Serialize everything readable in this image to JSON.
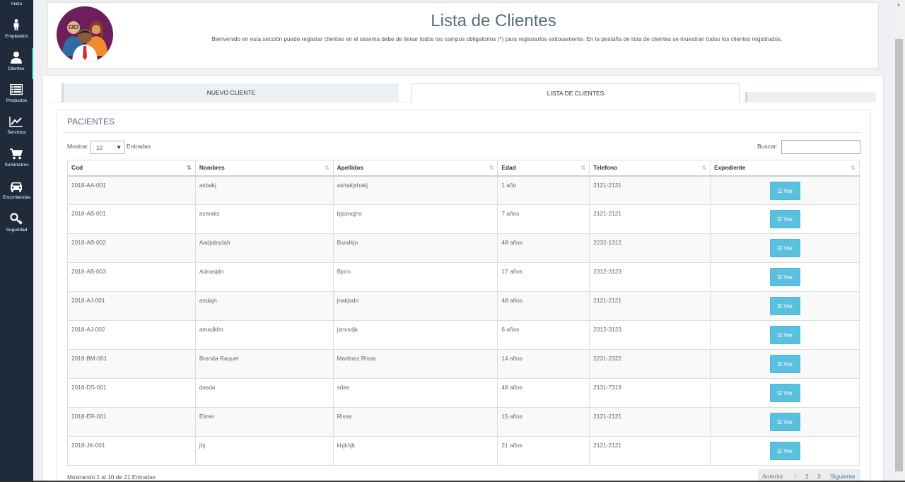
{
  "sidebar": {
    "items": [
      {
        "label": "Inicio",
        "icon": "home-icon"
      },
      {
        "label": "Empleados",
        "icon": "person-icon"
      },
      {
        "label": "Clientes",
        "icon": "user-icon"
      },
      {
        "label": "Productos",
        "icon": "list-icon"
      },
      {
        "label": "Servicios",
        "icon": "chart-icon"
      },
      {
        "label": "Suministros",
        "icon": "cart-icon"
      },
      {
        "label": "Encomiendas",
        "icon": "car-icon"
      },
      {
        "label": "Seguridad",
        "icon": "key-icon"
      }
    ],
    "active": "Clientes"
  },
  "header": {
    "title": "Lista de Clientes",
    "subtitle": "Bienvenido en esta sección puede registrar clientes en el sistema debe de llenar todos los campos obligatorios (*) para registrarlos exitosamente. En la pestaña de lista de clientes se muestran todos los clientes registrados."
  },
  "tabs": {
    "new": "NUEVO CLIENTE",
    "list": "LISTA DE CLIENTES"
  },
  "section": {
    "title": "PACIENTES"
  },
  "controls": {
    "show_label": "Mostrar",
    "show_value": "10",
    "entries_label": "Entradas",
    "search_label": "Buscar:",
    "search_value": ""
  },
  "table": {
    "headers": [
      "Cod",
      "Nombres",
      "Apellidos",
      "Edad",
      "Telefono",
      "Expediente"
    ],
    "button_label": "Ver",
    "rows": [
      [
        "2018-AA-001",
        "asbakj",
        "ashakjshakj",
        "1 año",
        "2121-2121"
      ],
      [
        "2018-AB-001",
        "asmaks",
        "bjqsnqjns",
        "7 años",
        "2121-2121"
      ],
      [
        "2018-AB-002",
        "Aadjabsdah",
        "Bsndkjn",
        "48 años",
        "2232-1312"
      ],
      [
        "2018-AB-003",
        "Adnasjdn",
        "Bjoro",
        "17 años",
        "2312-3123"
      ],
      [
        "2018-AJ-001",
        "andajn",
        "jnakjsdn",
        "48 años",
        "2121-2121"
      ],
      [
        "2018-AJ-002",
        "amadkfm",
        "jsnvsdjk",
        "6 años",
        "2312-3123"
      ],
      [
        "2018-BM-001",
        "Brenda Raquel",
        "Martinez Rivas",
        "14 años",
        "2231-2322"
      ],
      [
        "2018-DS-001",
        "dasda",
        "sdas",
        "48 años",
        "2131-7319"
      ],
      [
        "2018-ER-001",
        "Elmer",
        "Rivas",
        "15 años",
        "2121-2121"
      ],
      [
        "2018-JK-001",
        "jhj",
        "khjkhjk",
        "21 años",
        "2121-2121"
      ]
    ]
  },
  "footer": {
    "info": "Mostrando 1 al 10 de 21 Entradas",
    "prev": "Anterior",
    "pages": [
      "1",
      "2",
      "3"
    ],
    "next": "Siguiente"
  },
  "colors": {
    "sidebar": "#1f2a3a",
    "accent": "#1abc9c",
    "button": "#5bc0de",
    "title": "#5b6b80"
  }
}
